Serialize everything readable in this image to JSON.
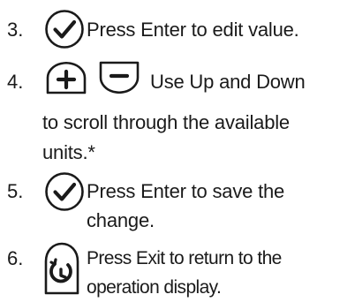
{
  "steps": [
    {
      "number": "3.",
      "icon": "enter-check-icon",
      "lines": [
        "Press Enter to edit value."
      ]
    },
    {
      "number": "4.",
      "icons": [
        "plus-icon",
        "minus-icon"
      ],
      "lines": [
        "Use Up and Down",
        "to scroll through the available",
        "units.*"
      ]
    },
    {
      "number": "5.",
      "icon": "enter-check-icon",
      "lines": [
        "Press Enter to save the",
        "change."
      ]
    },
    {
      "number": "6.",
      "icon": "exit-icon",
      "lines": [
        "Press Exit to return to the",
        "operation display."
      ]
    }
  ]
}
